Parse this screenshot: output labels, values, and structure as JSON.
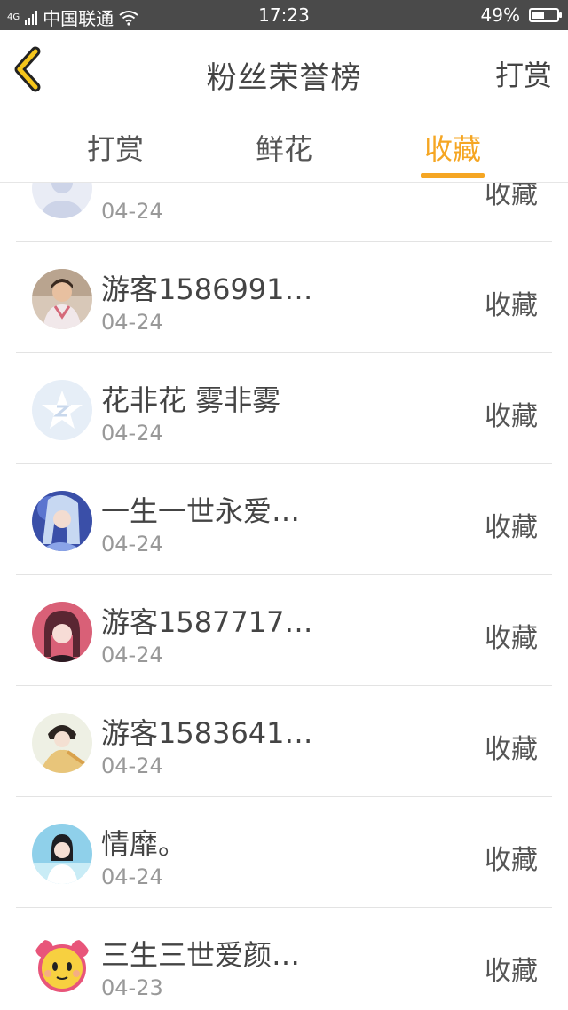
{
  "status_bar": {
    "signal_label": "4G",
    "carrier": "中国联通",
    "time": "17:23",
    "battery": "49%",
    "battery_level": 0.49
  },
  "nav": {
    "title": "粉丝荣誉榜",
    "right_action": "打赏",
    "back_icon": "chevron-left-icon"
  },
  "tabs": [
    {
      "label": "打赏",
      "active": false
    },
    {
      "label": "鲜花",
      "active": false
    },
    {
      "label": "收藏",
      "active": true
    }
  ],
  "colors": {
    "accent": "#f5a623",
    "text_primary": "#444444",
    "text_secondary": "#999999"
  },
  "fans": [
    {
      "name": "",
      "date": "04-24",
      "action": "收藏"
    },
    {
      "name": "游客1586991…",
      "date": "04-24",
      "action": "收藏"
    },
    {
      "name": "花非花 雾非雾",
      "date": "04-24",
      "action": "收藏"
    },
    {
      "name": "一生一世永爱…",
      "date": "04-24",
      "action": "收藏"
    },
    {
      "name": "游客1587717…",
      "date": "04-24",
      "action": "收藏"
    },
    {
      "name": "游客1583641…",
      "date": "04-24",
      "action": "收藏"
    },
    {
      "name": "情靡。",
      "date": "04-24",
      "action": "收藏"
    },
    {
      "name": "三生三世爱颜…",
      "date": "04-23",
      "action": "收藏"
    }
  ]
}
